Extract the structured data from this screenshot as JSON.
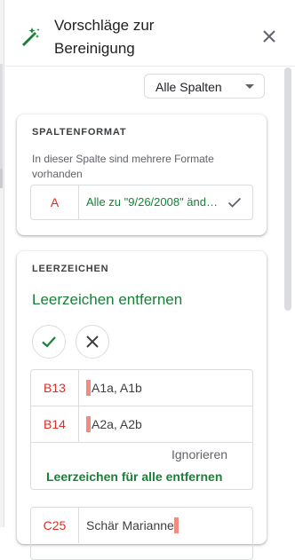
{
  "header": {
    "title": "Vorschläge zur Bereinigung",
    "icons": {
      "app": "magic-wand-icon",
      "close": "close-icon"
    }
  },
  "filter": {
    "selected": "Alle Spalten"
  },
  "format_card": {
    "title": "SPALTENFORMAT",
    "description": "In dieser Spalte sind mehrere Formate vorhanden",
    "column": "A",
    "suggestion": "Alle zu \"9/26/2008\" ändern"
  },
  "whitespace_card": {
    "title": "LEERZEICHEN",
    "action": "Leerzeichen entfernen",
    "rows": [
      {
        "cell": "B13",
        "value": "A1a, A1b"
      },
      {
        "cell": "B14",
        "value": "A2a, A2b"
      }
    ],
    "ignore": "Ignorieren",
    "remove_all": "Leerzeichen für alle entfernen",
    "next_row": {
      "cell": "C25",
      "value": "Schär Marianne"
    }
  },
  "colors": {
    "green": "#188038",
    "red": "#d93025",
    "marker": "#f28b82"
  }
}
